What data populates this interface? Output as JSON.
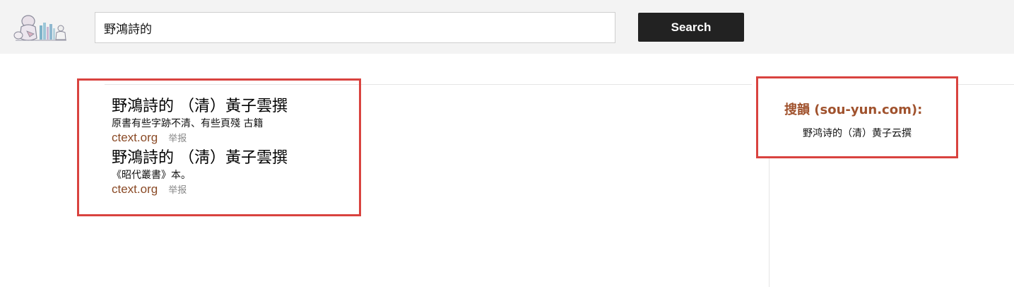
{
  "header": {
    "logo_icon": "reading-child-books-logo",
    "search": {
      "value": "野鴻詩的",
      "placeholder": ""
    },
    "search_button_label": "Search"
  },
  "results": [
    {
      "title": "野鴻詩的 （清）黃子雲撰",
      "snippet": "原書有些字跡不清、有些頁殘 古籍",
      "domain": "ctext.org",
      "report_label": "举报"
    },
    {
      "title": "野鴻詩的 （淸）黃子雲撰",
      "snippet": "《昭代叢書》本。",
      "domain": "ctext.org",
      "report_label": "举报"
    }
  ],
  "sidebar": {
    "title": "搜韻 (sou-yun.com):",
    "link": "野鸿诗的（清）黄子云撰"
  },
  "colors": {
    "highlight_border": "#d9433f",
    "domain": "#8a4a26",
    "sidebar_title": "#a0522d",
    "search_button_bg": "#222222",
    "header_bg": "#f3f3f3"
  }
}
